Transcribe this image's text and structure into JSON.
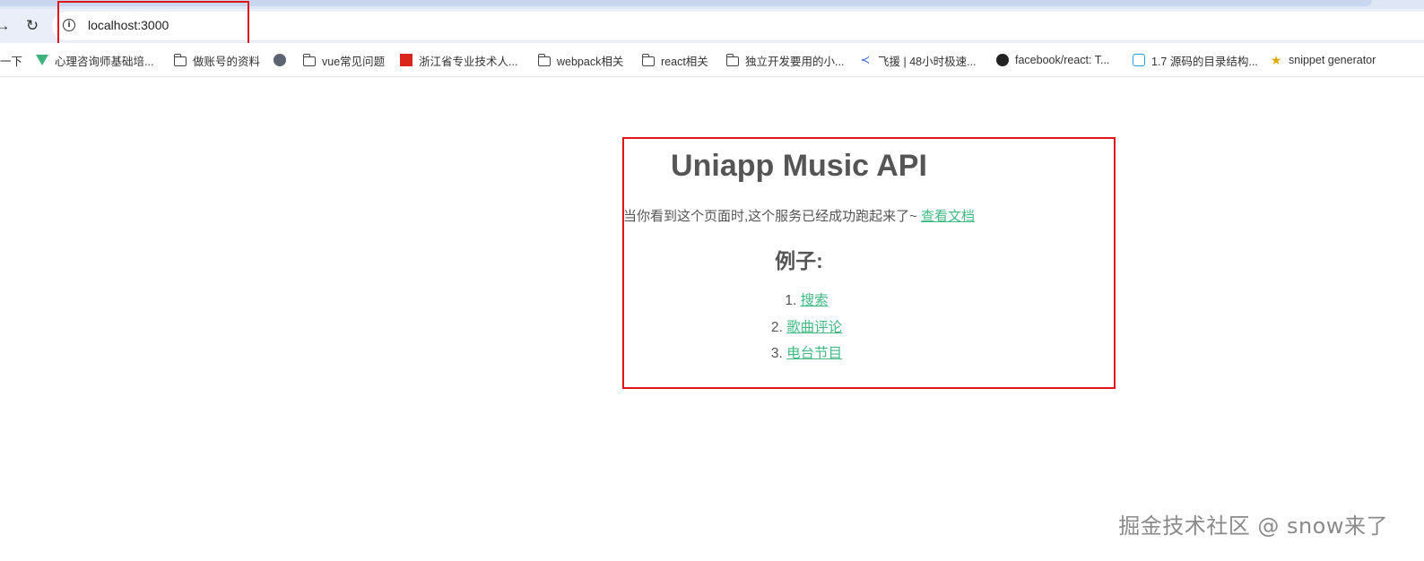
{
  "browser": {
    "url": "localhost:3000",
    "bookmarks": [
      {
        "label": "一下",
        "icon": "none"
      },
      {
        "label": "心理咨询师基础培...",
        "icon": "vue-logo-icon"
      },
      {
        "label": "做账号的资料",
        "icon": "folder-icon"
      },
      {
        "label": "",
        "icon": "globe-icon"
      },
      {
        "label": "vue常见问题",
        "icon": "folder-icon"
      },
      {
        "label": "浙江省专业技术人...",
        "icon": "site-logo-icon"
      },
      {
        "label": "webpack相关",
        "icon": "folder-icon"
      },
      {
        "label": "react相关",
        "icon": "folder-icon"
      },
      {
        "label": "独立开发要用的小...",
        "icon": "folder-icon"
      },
      {
        "label": "飞援 | 48小时极速...",
        "icon": "feiyuan-icon"
      },
      {
        "label": "facebook/react: T...",
        "icon": "github-icon"
      },
      {
        "label": "1.7 源码的目录结构...",
        "icon": "bilibili-icon"
      },
      {
        "label": "snippet generator",
        "icon": "star-icon"
      }
    ]
  },
  "page": {
    "title": "Uniapp Music API",
    "subtitle_text": "当你看到这个页面时,这个服务已经成功跑起来了~",
    "subtitle_link": "查看文档",
    "examples_heading": "例子:",
    "examples": [
      {
        "num": "1.",
        "label": "搜索"
      },
      {
        "num": "2.",
        "label": "歌曲评论"
      },
      {
        "num": "3.",
        "label": "电台节目"
      }
    ]
  },
  "watermark": "掘金技术社区 @ snow来了",
  "colors": {
    "link": "#42b983",
    "annotation_box": "#e0161b",
    "toolbar": "#e9eef8"
  }
}
